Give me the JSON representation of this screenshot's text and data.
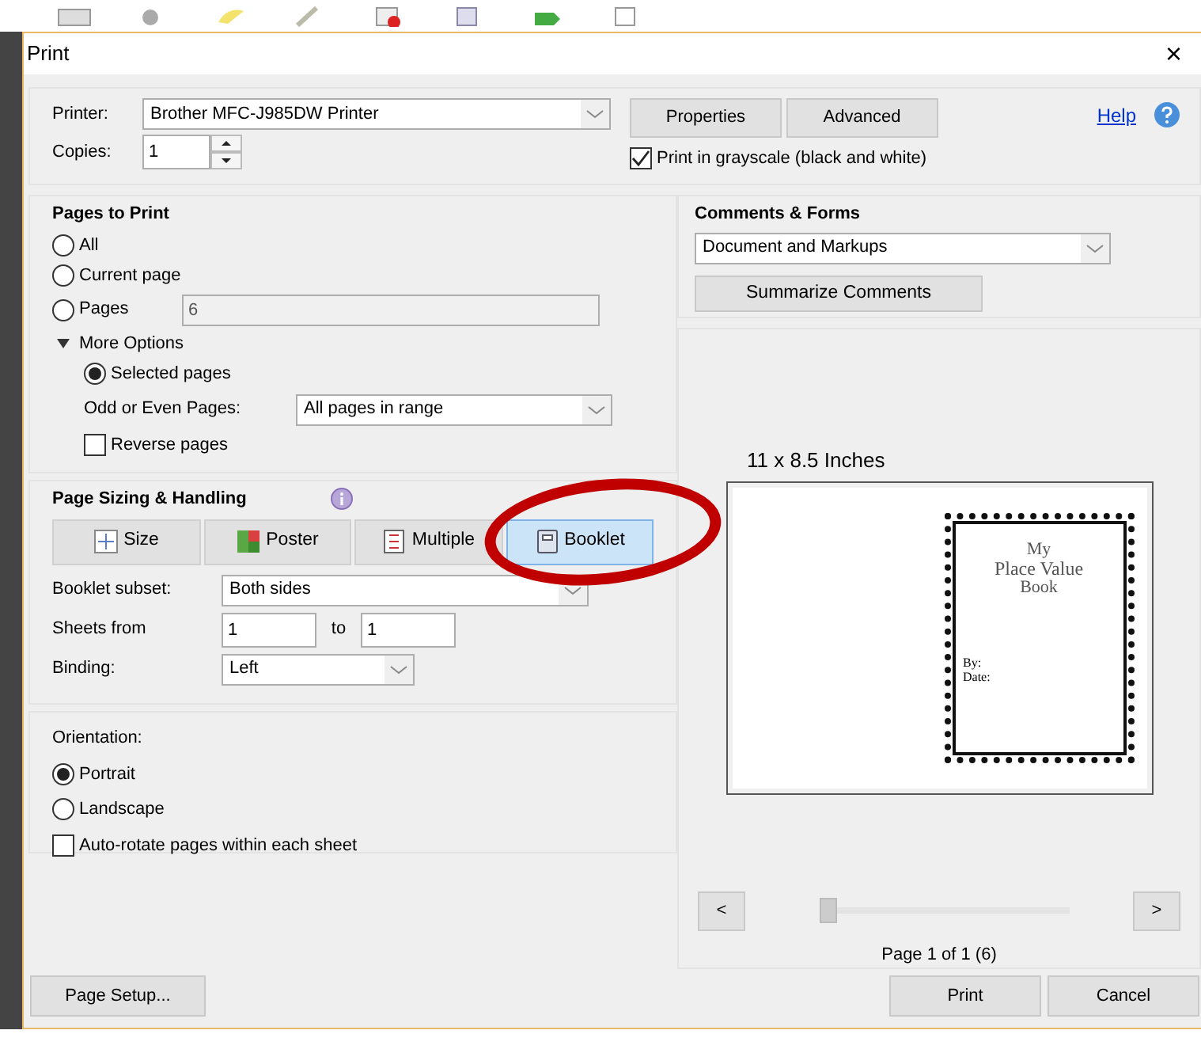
{
  "window": {
    "title": "Print",
    "close": "×"
  },
  "printer": {
    "label": "Printer:",
    "value": "Brother MFC-J985DW Printer"
  },
  "top_buttons": [
    {
      "label": "Properties"
    },
    {
      "label": "Advanced"
    }
  ],
  "help": "Help",
  "copies": {
    "label": "Copies:",
    "value": "1"
  },
  "grayscale": {
    "label": "Print in grayscale (black and white)",
    "checked": true
  },
  "pages_to_print": {
    "title": "Pages to Print",
    "options": [
      {
        "label": "All",
        "selected": false
      },
      {
        "label": "Current page",
        "selected": false
      },
      {
        "label": "Pages",
        "selected": false,
        "value": "6"
      }
    ],
    "more_options": {
      "label": "More Options",
      "expanded": true,
      "options": [
        {
          "label": "Selected pages",
          "selected": true
        }
      ],
      "odd_even": {
        "label": "Odd or Even Pages:",
        "value": "All pages in range"
      },
      "reverse": {
        "label": "Reverse pages",
        "checked": false
      }
    }
  },
  "sizing": {
    "title": "Page Sizing & Handling",
    "tabs": [
      {
        "kind": "size",
        "label": "Size",
        "selected": false
      },
      {
        "kind": "poster",
        "label": "Poster",
        "selected": false
      },
      {
        "kind": "multiple",
        "label": "Multiple",
        "selected": false
      },
      {
        "kind": "booklet",
        "label": "Booklet",
        "selected": true
      }
    ],
    "subset": {
      "label": "Booklet subset:",
      "value": "Both sides"
    },
    "sheets": {
      "label": "Sheets from",
      "from": "1",
      "to_label": "to",
      "to": "1"
    },
    "binding": {
      "label": "Binding:",
      "value": "Left"
    }
  },
  "orientation": {
    "label": "Orientation:",
    "options": [
      {
        "label": "Portrait",
        "selected": true
      },
      {
        "label": "Landscape",
        "selected": false
      }
    ],
    "auto_rotate": {
      "label": "Auto-rotate pages within each sheet",
      "checked": false
    }
  },
  "comments": {
    "title": "Comments & Forms",
    "value": "Document and Markups",
    "button": "Summarize Comments"
  },
  "preview": {
    "size": "11 x 8.5 Inches",
    "texts": [
      "My",
      "Place Value",
      "Book",
      "By:",
      "Date:"
    ],
    "prev": "<",
    "next": ">",
    "level": 0,
    "page": "Page 1 of 1 (6)"
  },
  "footer": {
    "page_setup": "Page Setup...",
    "print": "Print",
    "cancel": "Cancel"
  }
}
